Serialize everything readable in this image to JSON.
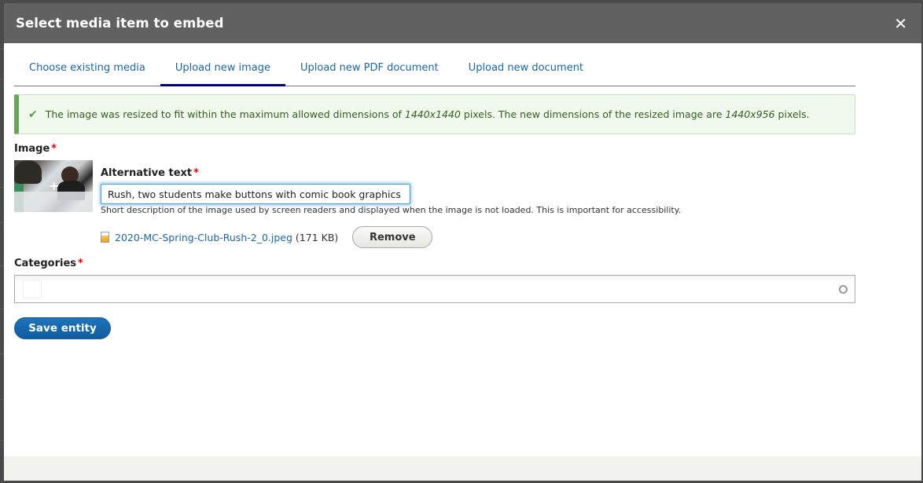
{
  "dialog": {
    "title": "Select media item to embed",
    "close_icon": "close-icon (×)",
    "close_glyph": "✕"
  },
  "tabs": [
    {
      "label": "Choose existing media",
      "active": false
    },
    {
      "label": "Upload new image",
      "active": true
    },
    {
      "label": "Upload new PDF document",
      "active": false
    },
    {
      "label": "Upload new document",
      "active": false
    }
  ],
  "status_message": {
    "icon": "check-icon",
    "glyph": "✔",
    "text_1": "The image was resized to fit within the maximum allowed dimensions of ",
    "max_dimensions": "1440x1440",
    "text_2": " pixels. The new dimensions of the resized image are ",
    "new_dimensions": "1440x956",
    "text_3": " pixels.",
    "color": "#325e1c"
  },
  "image_field": {
    "label": "Image",
    "required_marker": "*",
    "thumbnail_alt": "Two students make buttons with comic book graphics",
    "alt_text": {
      "label": "Alternative text",
      "required_marker": "*",
      "value": "Rush, two students make buttons with comic book graphics",
      "description": "Short description of the image used by screen readers and displayed when the image is not loaded. This is important for accessibility."
    },
    "file": {
      "name": "2020-MC-Spring-Club-Rush-2_0.jpeg",
      "size": "(171 KB)",
      "remove_label": "Remove"
    }
  },
  "categories": {
    "label": "Categories",
    "required_marker": "*",
    "value": ""
  },
  "actions": {
    "save_label": "Save entity",
    "save_color": "#1e74bb"
  }
}
